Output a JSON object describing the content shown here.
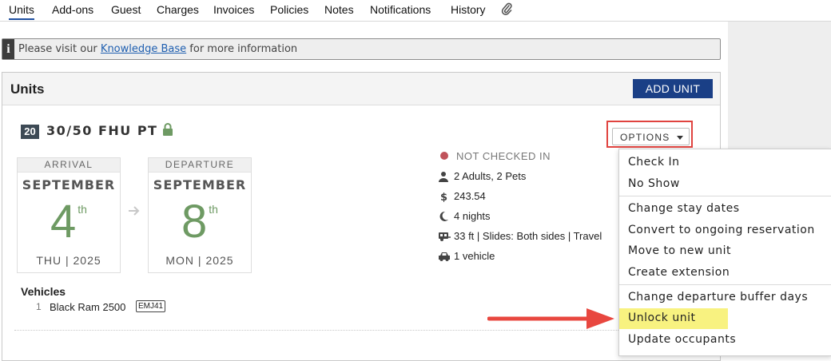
{
  "tabs": [
    {
      "label": "Units",
      "active": true
    },
    {
      "label": "Add-ons"
    },
    {
      "label": "Guest"
    },
    {
      "label": "Charges"
    },
    {
      "label": "Invoices"
    },
    {
      "label": "Policies"
    },
    {
      "label": "Notes"
    },
    {
      "label": "Notifications"
    },
    {
      "label": "History"
    }
  ],
  "attachments_icon": "paperclip-icon",
  "info_bar": {
    "icon": "info-icon",
    "prefix": "Please visit our ",
    "link": "Knowledge Base",
    "suffix": " for more information"
  },
  "units_panel": {
    "title": "Units",
    "add_unit_label": "ADD UNIT",
    "unit": {
      "site_number": "20",
      "site_name": "30/50 FHU PT",
      "locked": true,
      "arrival": {
        "header": "ARRIVAL",
        "month": "SEPTEMBER",
        "day": "4",
        "suffix": "th",
        "weekday_year": "THU | 2025"
      },
      "departure": {
        "header": "DEPARTURE",
        "month": "SEPTEMBER",
        "day": "8",
        "suffix": "th",
        "weekday_year": "MON | 2025"
      },
      "status": "NOT CHECKED IN",
      "occupants": "2 Adults, 2 Pets",
      "amount": "243.54",
      "nights": "4 nights",
      "rig": "33 ft | Slides: Both sides | Travel",
      "vehicle_count": "1 vehicle",
      "vehicles_title": "Vehicles",
      "vehicles": [
        {
          "index": "1",
          "name": "Black Ram 2500",
          "plate": "EMJ41"
        }
      ]
    },
    "options_label": "OPTIONS",
    "options_menu": [
      [
        "Check In",
        "No Show"
      ],
      [
        "Change stay dates",
        "Convert to ongoing reservation",
        "Move to new unit",
        "Create extension"
      ],
      [
        "Change departure buffer days",
        "Unlock unit",
        "Update occupants"
      ]
    ],
    "highlighted_option": "Unlock unit"
  },
  "colors": {
    "primary_button": "#1a3f86",
    "callout_red": "#e0433f",
    "highlight_yellow": "#f8f280",
    "date_green": "#6e9a63",
    "status_red": "#c0525a"
  }
}
